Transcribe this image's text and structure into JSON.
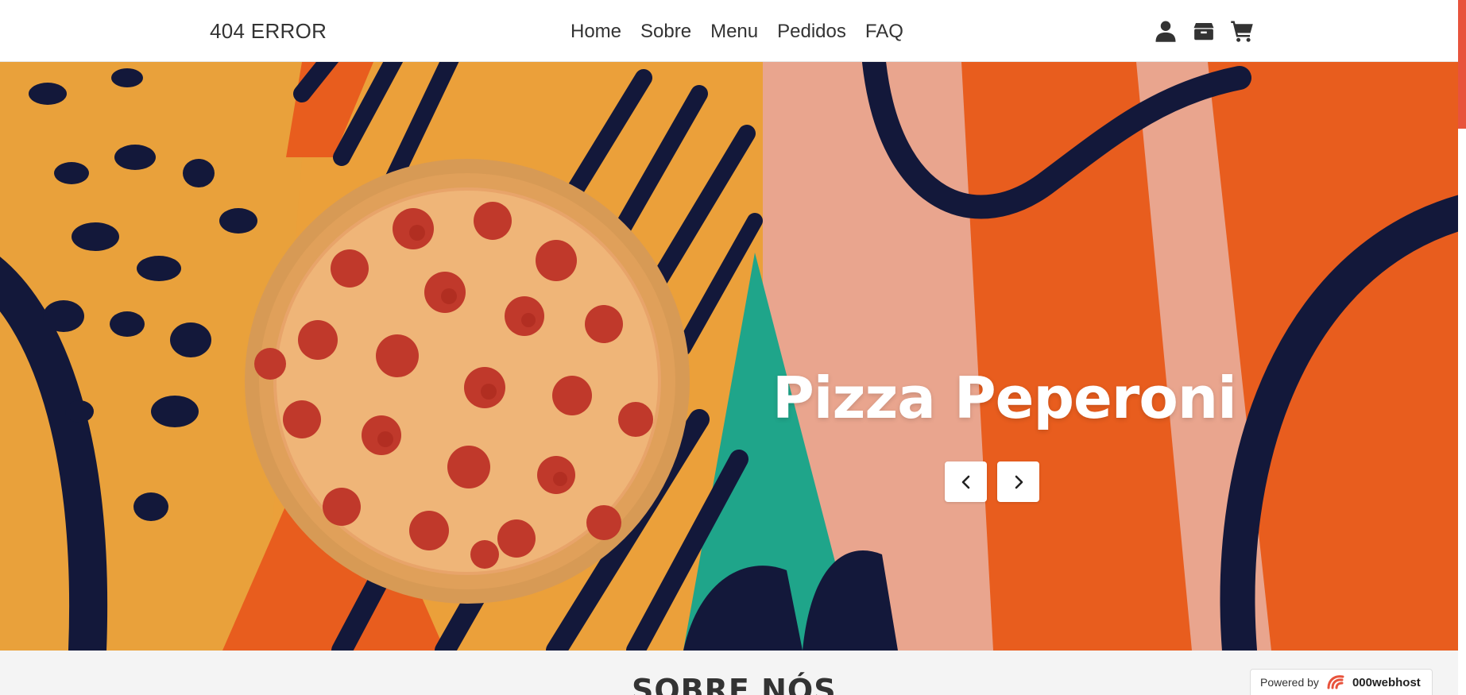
{
  "navbar": {
    "brand": "404 ERROR",
    "links": [
      "Home",
      "Sobre",
      "Menu",
      "Pedidos",
      "FAQ"
    ],
    "icons": [
      "user-icon",
      "box-icon",
      "cart-icon"
    ]
  },
  "hero": {
    "title": "Pizza Peperoni",
    "prev_icon": "chevron-left-icon",
    "next_icon": "chevron-right-icon"
  },
  "about": {
    "title": "SOBRE NÓS"
  },
  "footer_badge": {
    "label": "Powered by",
    "brand": "000webhost"
  },
  "colors": {
    "accent": "#e8533c",
    "text": "#333333",
    "hero_orange": "#e85d1e",
    "hero_yellow": "#eba03a",
    "hero_navy": "#13183a",
    "hero_teal": "#1fa58a",
    "hero_pink": "#e9a58e"
  }
}
